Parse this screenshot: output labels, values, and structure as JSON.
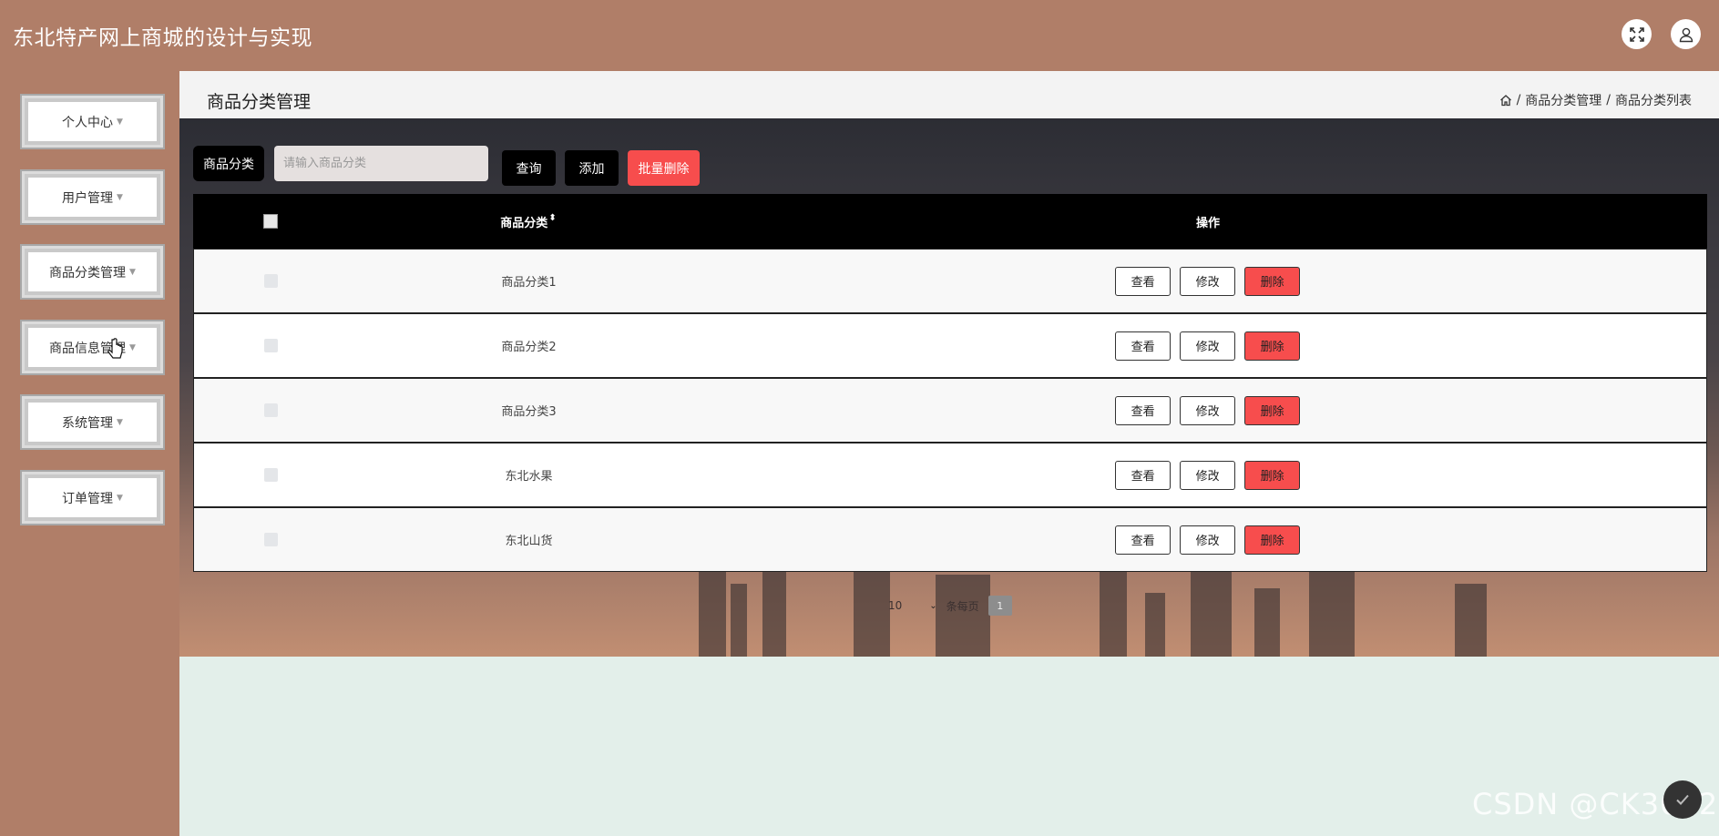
{
  "header": {
    "title": "东北特产网上商城的设计与实现",
    "fullscreen_icon": "fullscreen-icon",
    "user_icon": "user-icon"
  },
  "sidebar": {
    "items": [
      {
        "label": "个人中心"
      },
      {
        "label": "用户管理"
      },
      {
        "label": "商品分类管理"
      },
      {
        "label": "商品信息管理"
      },
      {
        "label": "系统管理"
      },
      {
        "label": "订单管理"
      }
    ]
  },
  "page": {
    "title": "商品分类管理",
    "breadcrumb": [
      "商品分类管理",
      "商品分类列表"
    ],
    "breadcrumb_sep": "/"
  },
  "search": {
    "label": "商品分类",
    "placeholder": "请输入商品分类",
    "query_label": "查询",
    "add_label": "添加",
    "batch_delete_label": "批量删除"
  },
  "table": {
    "headers": [
      "商品分类",
      "操作"
    ],
    "sort_glyph": "⬍",
    "rows": [
      {
        "name": "商品分类1"
      },
      {
        "name": "商品分类2"
      },
      {
        "name": "商品分类3"
      },
      {
        "name": "东北水果"
      },
      {
        "name": "东北山货"
      }
    ],
    "actions": {
      "view": "查看",
      "edit": "修改",
      "delete": "删除"
    }
  },
  "pagination": {
    "page_size": "10",
    "per_page_label": "条每页",
    "current_page": "1"
  },
  "watermark": "CSDN @CK3042",
  "colors": {
    "header_bg": "#b07e68",
    "danger": "#f74d4d",
    "main_bg": "#e3efea"
  }
}
